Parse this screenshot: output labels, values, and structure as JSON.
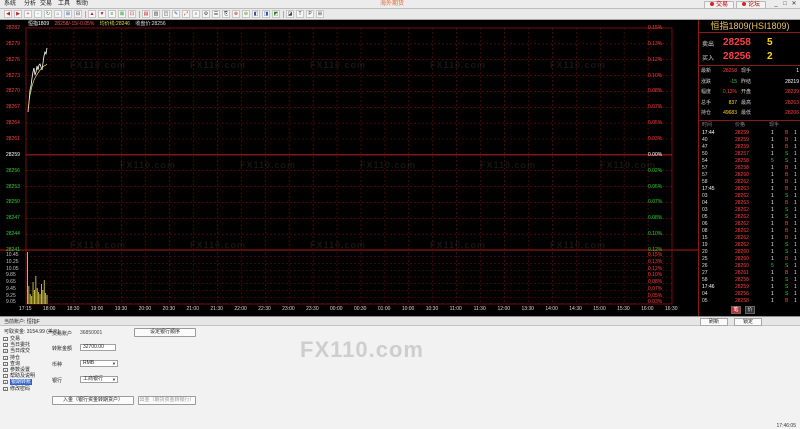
{
  "menu": [
    "系统",
    "分析",
    "交易",
    "工具",
    "帮助"
  ],
  "app_title": "海外期货",
  "top_buttons": {
    "trade": "交易",
    "forum": "论坛"
  },
  "toolbar": [
    "◀",
    "▶",
    "+",
    "-",
    "↻",
    "⌂",
    "⊞",
    "⊟",
    "▲",
    "▼",
    "≡",
    "⊠",
    "⊡",
    "▤",
    "▥",
    "◫",
    "✎",
    "⤢",
    "⌕",
    "⚙",
    "☰",
    "⎘",
    "⊕",
    "⊖",
    "◧",
    "◨",
    "◩",
    "◪",
    "T",
    "P",
    "⊞"
  ],
  "chart": {
    "legend": {
      "name": "恒指1809",
      "price": "28258/-15/-0.05%",
      "avg": "均价线:28246",
      "close": "收盘价:28256"
    },
    "price_labels": [
      "28282",
      "28279",
      "28276",
      "28273",
      "28270",
      "28267",
      "28264",
      "28261",
      "28259",
      "28256",
      "28253",
      "28250",
      "28247",
      "28244",
      "28241"
    ],
    "pct_labels": [
      "0.15%",
      "0.13%",
      "0.12%",
      "0.10%",
      "0.08%",
      "0.07%",
      "0.05%",
      "0.03%",
      "0.00%",
      "0.02%",
      "0.05%",
      "0.07%",
      "0.08%",
      "0.10%",
      "0.12%"
    ],
    "vol_labels": [
      "10.45",
      "10.25",
      "10.05",
      "9.85",
      "9.65",
      "9.45",
      "9.25",
      "9.05"
    ],
    "vol_pct": [
      "0.15%",
      "0.13%",
      "0.12%",
      "0.10%",
      "0.08%",
      "0.07%",
      "0.05%",
      "0.03%"
    ],
    "time_labels": [
      "17:15",
      "18:00",
      "18:30",
      "19:00",
      "19:30",
      "20:00",
      "20:30",
      "21:00",
      "21:30",
      "22:00",
      "22:30",
      "23:00",
      "23:30",
      "00:00",
      "00:30",
      "01:00",
      "10:00",
      "10:30",
      "11:00",
      "11:30",
      "12:00",
      "13:30",
      "14:00",
      "14:30",
      "15:00",
      "15:30",
      "16:00",
      "16:30"
    ],
    "watermark": "FX110.com"
  },
  "quote": {
    "title": "恒指1809(HSI1809)",
    "ask_label": "卖出",
    "ask_price": "28258",
    "ask_qty": "5",
    "bid_label": "买入",
    "bid_price": "28256",
    "bid_qty": "2",
    "stats": [
      {
        "k1": "最新",
        "v1": "28258",
        "k2": "现手",
        "v2": "1"
      },
      {
        "k1": "涨跌",
        "v1": "-15",
        "k2": "昨结",
        "v2": "28219"
      },
      {
        "k1": "幅度",
        "v1": "0.13%",
        "k2": "开盘",
        "v2": "28239"
      },
      {
        "k1": "总手",
        "v1": "837",
        "k2": "最高",
        "v2": "28263"
      },
      {
        "k1": "持仓",
        "v1": "49683",
        "k2": "最低",
        "v2": "28206"
      }
    ],
    "tick_header": {
      "time": "时间",
      "price": "价格",
      "qty": "现手"
    },
    "ticks": [
      {
        "t": "17:44",
        "p": "28259",
        "v": "1",
        "f": "B",
        "n": "1"
      },
      {
        "t": "40",
        "p": "28259",
        "v": "1",
        "f": "B",
        "n": "1"
      },
      {
        "t": "47",
        "p": "28259",
        "v": "1",
        "f": "B",
        "n": "1"
      },
      {
        "t": "50",
        "p": "28257",
        "v": "1",
        "f": "S",
        "n": "1"
      },
      {
        "t": "54",
        "p": "28258",
        "v": "5",
        "f": "S",
        "n": "1"
      },
      {
        "t": "57",
        "p": "28258",
        "v": "1",
        "f": "B",
        "n": "1"
      },
      {
        "t": "57",
        "p": "28260",
        "v": "1",
        "f": "B",
        "n": "1"
      },
      {
        "t": "58",
        "p": "28262",
        "v": "1",
        "f": "B",
        "n": "1"
      },
      {
        "t": "17:45",
        "p": "28263",
        "v": "1",
        "f": "B",
        "n": "1"
      },
      {
        "t": "03",
        "p": "28262",
        "v": "1",
        "f": "S",
        "n": "1"
      },
      {
        "t": "04",
        "p": "28263",
        "v": "1",
        "f": "B",
        "n": "1"
      },
      {
        "t": "03",
        "p": "28262",
        "v": "1",
        "f": "S",
        "n": "1"
      },
      {
        "t": "05",
        "p": "28262",
        "v": "1",
        "f": "S",
        "n": "1"
      },
      {
        "t": "06",
        "p": "28262",
        "v": "1",
        "f": "B",
        "n": "1"
      },
      {
        "t": "08",
        "p": "28262",
        "v": "1",
        "f": "B",
        "n": "1"
      },
      {
        "t": "15",
        "p": "28262",
        "v": "1",
        "f": "B",
        "n": "1"
      },
      {
        "t": "19",
        "p": "28262",
        "v": "1",
        "f": "S",
        "n": "1"
      },
      {
        "t": "20",
        "p": "28260",
        "v": "1",
        "f": "S",
        "n": "1"
      },
      {
        "t": "25",
        "p": "28260",
        "v": "1",
        "f": "B",
        "n": "1"
      },
      {
        "t": "26",
        "p": "28260",
        "v": "5",
        "f": "S",
        "n": "1"
      },
      {
        "t": "27",
        "p": "28261",
        "v": "1",
        "f": "B",
        "n": "1"
      },
      {
        "t": "58",
        "p": "28258",
        "v": "1",
        "f": "S",
        "n": "1"
      },
      {
        "t": "17:46",
        "p": "28259",
        "v": "1",
        "f": "S",
        "n": "1"
      },
      {
        "t": "04",
        "p": "28256",
        "v": "1",
        "f": "S",
        "n": "1"
      },
      {
        "t": "05",
        "p": "28258",
        "v": "1",
        "f": "B",
        "n": "1"
      }
    ],
    "tabs": [
      "笔",
      "价"
    ]
  },
  "panel": {
    "header": "当前账户: 恒指F",
    "btn_refresh": "刷新",
    "btn_lock": "锁定",
    "tree": [
      {
        "icon": "+",
        "label": "交易"
      },
      {
        "icon": "+",
        "label": "当日委托"
      },
      {
        "icon": "+",
        "label": "当日成交"
      },
      {
        "icon": "+",
        "label": "持仓"
      },
      {
        "icon": "+",
        "label": "查询"
      },
      {
        "icon": "+",
        "label": "参数设置"
      },
      {
        "icon": "+",
        "label": "帮助及说明"
      },
      {
        "icon": "+",
        "label": "银期转账"
      },
      {
        "icon": "+",
        "label": "修改密码"
      }
    ],
    "balance_label": "可取资金: 3154.99 (美元)",
    "account_label": "交易账户",
    "account_value": "36850001",
    "amount_label": "转账金额",
    "amount_value": "32700.00",
    "currency_label": "币种",
    "currency_value": "RMB",
    "bank_label": "银行",
    "bank_value": "工商银行",
    "btn_set_bank": "设定银行顺序",
    "btn_in": "入金（银行资金转期货户）",
    "btn_out": "出金（期货资金转银行）",
    "clock": "17:46:05",
    "watermark": "FX110.com"
  },
  "colors": {
    "up": "#ff4040",
    "down": "#2fd02f",
    "grid": "#7a0e0e",
    "line": "#ffffff",
    "avg": "#e8d94a",
    "vol": "#d6c94a"
  }
}
